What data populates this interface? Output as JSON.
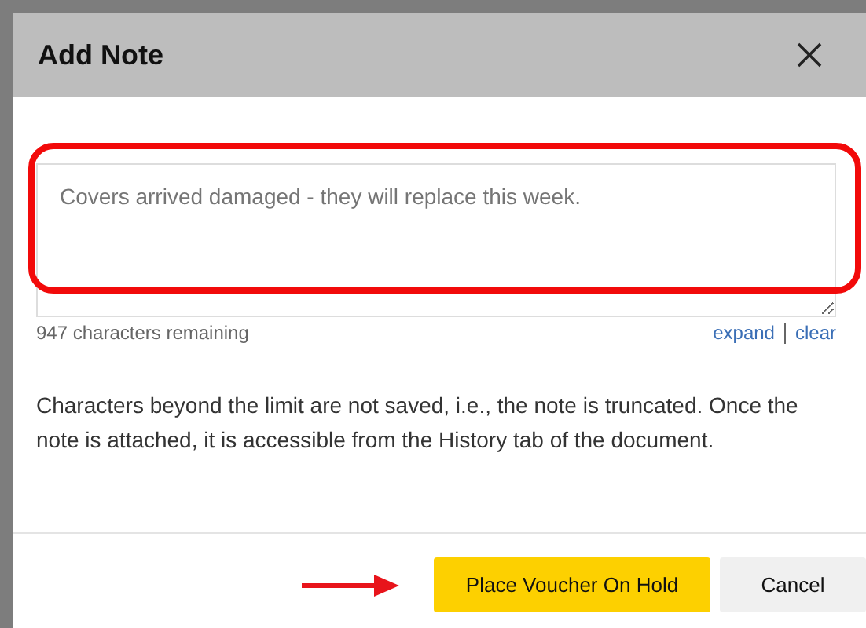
{
  "dialog": {
    "title": "Add Note",
    "note_field": {
      "value": "Covers arrived damaged - they will replace this week.",
      "highlighted": true
    },
    "counter": "947 characters remaining",
    "links": [
      "expand",
      "clear"
    ],
    "help_text": "Characters beyond the limit are not saved, i.e., the note is truncated. Once the note is attached, it is accessible from the History tab of the document.",
    "buttons": [
      {
        "label": "Place Voucher On Hold",
        "kind": "primary",
        "pointed": true
      },
      {
        "label": "Cancel",
        "kind": "secondary",
        "pointed": false
      }
    ]
  }
}
